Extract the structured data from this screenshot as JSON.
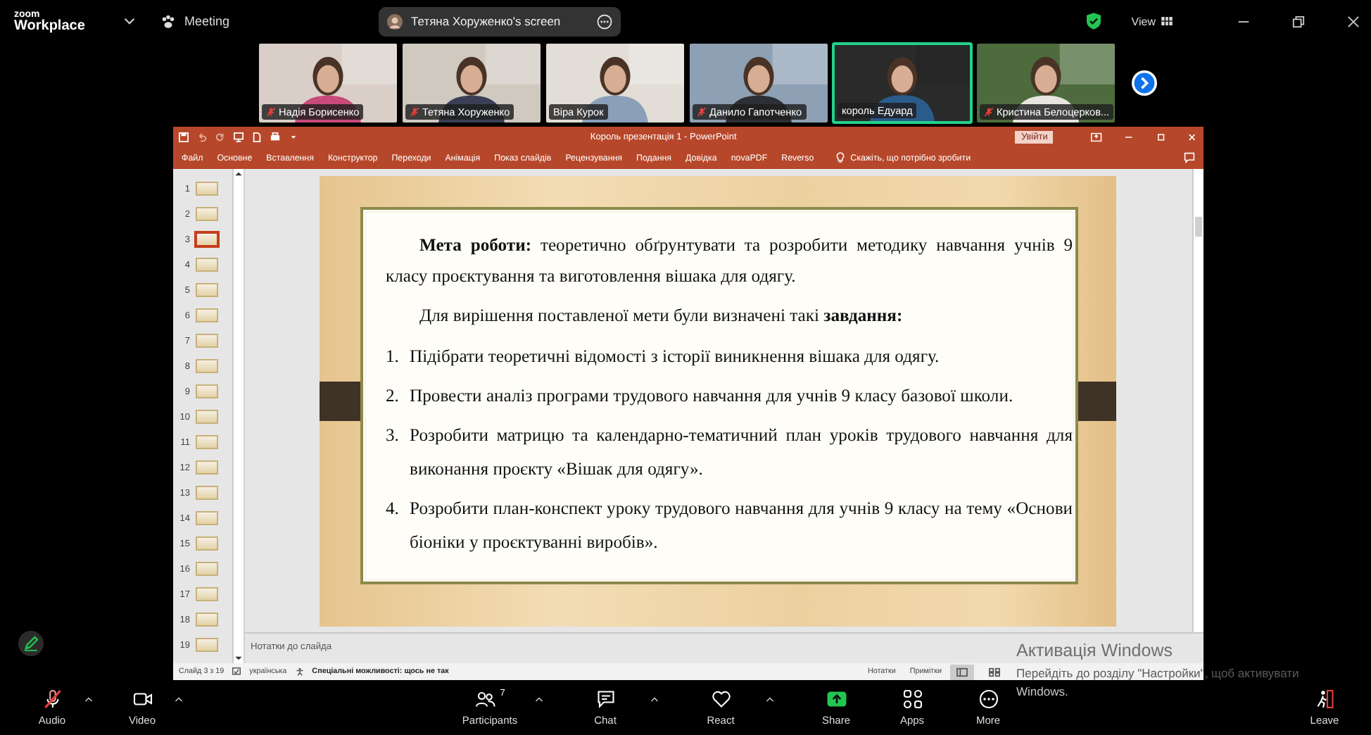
{
  "topbar": {
    "logo_top": "zoom",
    "logo_bottom": "Workplace",
    "meeting": "Meeting",
    "share_pill": "Тетяна Хоруженко's screen",
    "view": "View"
  },
  "gallery": [
    {
      "name": "Надія Борисенко",
      "muted": true,
      "speaking": false
    },
    {
      "name": "Тетяна Хоруженко",
      "muted": true,
      "speaking": false
    },
    {
      "name": "Віра Курок",
      "muted": false,
      "speaking": false
    },
    {
      "name": "Данило Гапотченко",
      "muted": true,
      "speaking": false
    },
    {
      "name": "король Едуард",
      "muted": false,
      "speaking": true
    },
    {
      "name": "Кристина Белоцерков...",
      "muted": true,
      "speaking": false
    }
  ],
  "powerpoint": {
    "title": "Король презентація 1  -  PowerPoint",
    "sign_in": "Увійти",
    "tabs": [
      "Файл",
      "Основне",
      "Вставлення",
      "Конструктор",
      "Переходи",
      "Анімація",
      "Показ слайдів",
      "Рецензування",
      "Подання",
      "Довідка",
      "novaPDF",
      "Reverso"
    ],
    "tell_me": "Скажіть, що потрібно зробити",
    "slides": [
      {
        "number": "1",
        "selected": false
      },
      {
        "number": "2",
        "selected": false
      },
      {
        "number": "3",
        "selected": true
      },
      {
        "number": "4",
        "selected": false
      },
      {
        "number": "5",
        "selected": false
      },
      {
        "number": "6",
        "selected": false
      },
      {
        "number": "7",
        "selected": false
      },
      {
        "number": "8",
        "selected": false
      },
      {
        "number": "9",
        "selected": false
      },
      {
        "number": "10",
        "selected": false
      },
      {
        "number": "11",
        "selected": false
      },
      {
        "number": "12",
        "selected": false
      },
      {
        "number": "13",
        "selected": false
      },
      {
        "number": "14",
        "selected": false
      },
      {
        "number": "15",
        "selected": false
      },
      {
        "number": "16",
        "selected": false
      },
      {
        "number": "17",
        "selected": false
      },
      {
        "number": "18",
        "selected": false
      },
      {
        "number": "19",
        "selected": false
      }
    ],
    "slide": {
      "aim": "**Мета роботи:** теоретично обґрунтувати та розробити методику навчання учнів 9 класу проєктування та виготовлення вішака для одягу.",
      "intro": "Для вирішення поставленої мети були визначені такі **завдання:**",
      "tasks": [
        {
          "number": "1.",
          "text": "Підібрати теоретичні відомості з історії виникнення вішака для одягу."
        },
        {
          "number": "2.",
          "text": "Провести аналіз програми трудового навчання для учнів 9 класу базової школи."
        },
        {
          "number": "3.",
          "text": "Розробити матрицю та календарно-тематичний план уроків трудового навчання для виконання проєкту «Вішак для одягу»."
        },
        {
          "number": "4.",
          "text": "Розробити план-конспект уроку трудового навчання для учнів 9 класу на тему «Основи біоніки у проєктуванні виробів»."
        }
      ]
    },
    "notes_placeholder": "Нотатки до слайда",
    "status": {
      "slide_counter": "Слайд 3 з 19",
      "language": "українська",
      "accessibility": "Спеціальні можливості: щось не так",
      "notes": "Нотатки",
      "comments": "Примітки"
    }
  },
  "activation": {
    "title": "Активація Windows",
    "hint": "Перейдіть до розділу \"Настройки\", щоб активувати",
    "hint_end": "Windows."
  },
  "toolbar_left": [
    {
      "kind": "audio",
      "label": "Audio",
      "muted": true
    },
    {
      "kind": "video",
      "label": "Video"
    }
  ],
  "toolbar_center": [
    {
      "kind": "participants",
      "label": "Participants",
      "count": "7"
    },
    {
      "kind": "chat",
      "label": "Chat"
    },
    {
      "kind": "react",
      "label": "React"
    },
    {
      "kind": "share",
      "label": "Share"
    },
    {
      "kind": "apps",
      "label": "Apps"
    },
    {
      "kind": "more",
      "label": "More"
    }
  ],
  "leave": "Leave"
}
